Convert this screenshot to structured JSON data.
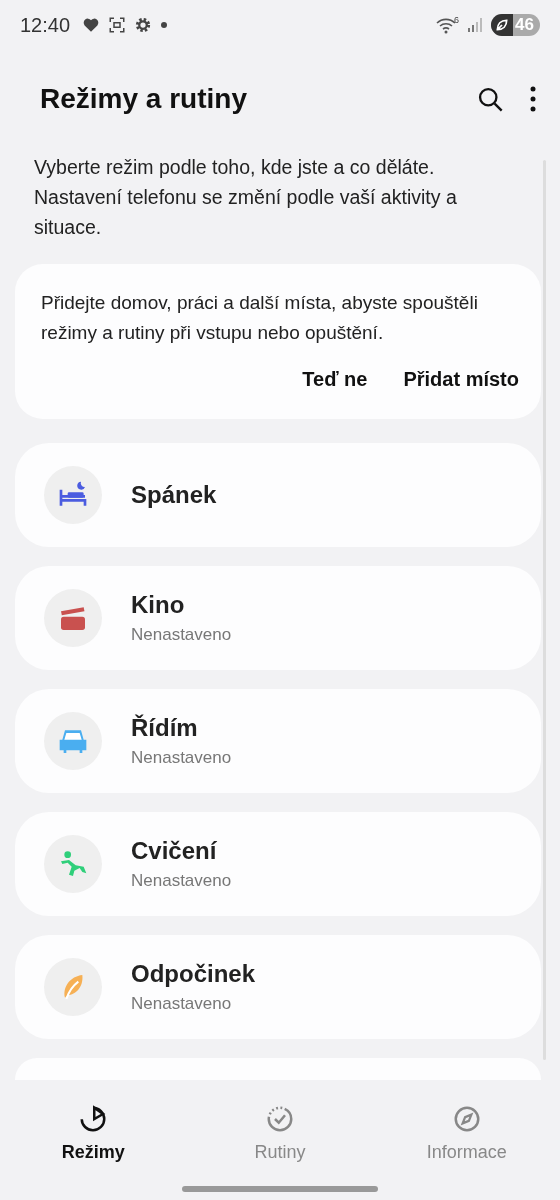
{
  "status_bar": {
    "time": "12:40",
    "wifi_badge": "6",
    "battery": "46"
  },
  "header": {
    "title": "Režimy a rutiny"
  },
  "description": "Vyberte režim podle toho, kde jste a co děláte. Nastavení telefonu se změní podle vaší aktivity a situace.",
  "place_prompt": {
    "text": "Přidejte domov, práci a další místa, abyste spouštěli režimy a rutiny při vstupu nebo opuštění.",
    "actions": [
      "Teď ne",
      "Přidat místo"
    ]
  },
  "modes": [
    {
      "kind": "sleep",
      "name": "Spánek"
    },
    {
      "kind": "movie",
      "name": "Kino",
      "status": "Nenastaveno"
    },
    {
      "kind": "drive",
      "name": "Řídím",
      "status": "Nenastaveno"
    },
    {
      "kind": "exercise",
      "name": "Cvičení",
      "status": "Nenastaveno"
    },
    {
      "kind": "relax",
      "name": "Odpočinek",
      "status": "Nenastaveno"
    }
  ],
  "bottom_nav": [
    {
      "kind": "modes",
      "label": "Režimy",
      "selected": true
    },
    {
      "kind": "routines",
      "label": "Rutiny",
      "selected": false
    },
    {
      "kind": "info",
      "label": "Informace",
      "selected": false
    }
  ]
}
